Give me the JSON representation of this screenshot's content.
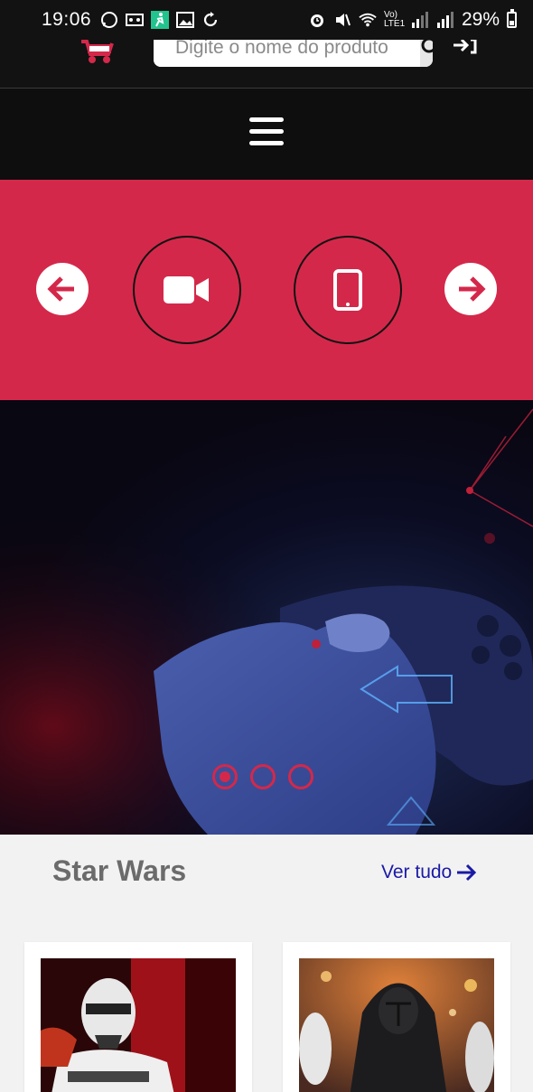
{
  "status_bar": {
    "time": "19:06",
    "network": "Vo) LTE1",
    "battery": "29%"
  },
  "header": {
    "search": {
      "placeholder": "Digite o nome do produto"
    }
  },
  "hero": {
    "slides": 3,
    "active_slide": 1
  },
  "section": {
    "title": "Star Wars",
    "see_all": "Ver tudo"
  },
  "colors": {
    "accent": "#d4284a",
    "header_bg": "#121212",
    "link": "#1a1aa6"
  },
  "icons": {
    "cart": "cart-icon",
    "search": "search-icon",
    "login": "login-icon",
    "menu": "hamburger-menu-icon",
    "prev": "arrow-left-icon",
    "next": "arrow-right-icon",
    "category_1": "video-camera-icon",
    "category_2": "smartphone-icon"
  }
}
